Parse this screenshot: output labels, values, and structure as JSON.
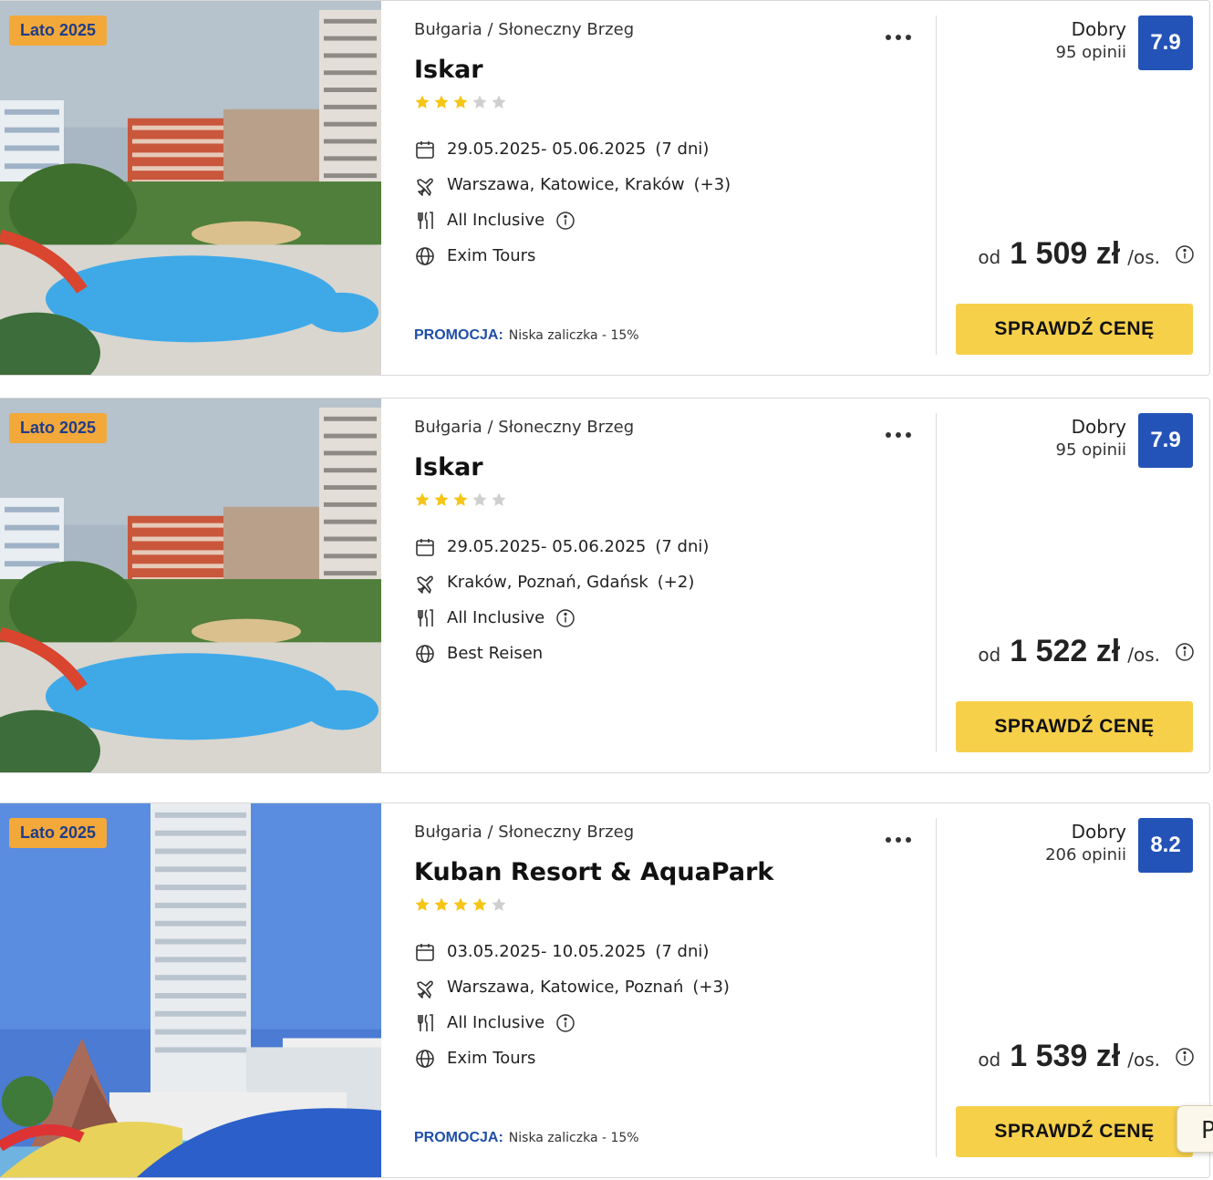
{
  "offers": [
    {
      "season_badge": "Lato 2025",
      "location": "Bułgaria / Słoneczny Brzeg",
      "name": "Iskar",
      "stars": 3,
      "dates": "29.05.2025- 05.06.2025",
      "duration": "(7 dni)",
      "departures": "Warszawa, Katowice, Kraków",
      "departures_more": "(+3)",
      "board": "All Inclusive",
      "operator": "Exim Tours",
      "promo_label": "PROMOCJA:",
      "promo_text": "Niska zaliczka - 15%",
      "rating_label": "Dobry",
      "reviews": "95 opinii",
      "score": "7.9",
      "price_from": "od",
      "price": "1 509 zł",
      "price_unit": "/os.",
      "cta": "SPRAWDŹ CENĘ",
      "photo": "hotel-pool"
    },
    {
      "season_badge": "Lato 2025",
      "location": "Bułgaria / Słoneczny Brzeg",
      "name": "Iskar",
      "stars": 3,
      "dates": "29.05.2025- 05.06.2025",
      "duration": "(7 dni)",
      "departures": "Kraków, Poznań, Gdańsk",
      "departures_more": "(+2)",
      "board": "All Inclusive",
      "operator": "Best Reisen",
      "promo_label": "",
      "promo_text": "",
      "rating_label": "Dobry",
      "reviews": "95 opinii",
      "score": "7.9",
      "price_from": "od",
      "price": "1 522 zł",
      "price_unit": "/os.",
      "cta": "SPRAWDŹ CENĘ",
      "photo": "hotel-pool"
    },
    {
      "season_badge": "Lato 2025",
      "location": "Bułgaria / Słoneczny Brzeg",
      "name": "Kuban Resort & AquaPark",
      "stars": 4,
      "dates": "03.05.2025- 10.05.2025",
      "duration": "(7 dni)",
      "departures": "Warszawa, Katowice, Poznań",
      "departures_more": "(+3)",
      "board": "All Inclusive",
      "operator": "Exim Tours",
      "promo_label": "PROMOCJA:",
      "promo_text": "Niska zaliczka - 15%",
      "rating_label": "Dobry",
      "reviews": "206 opinii",
      "score": "8.2",
      "price_from": "od",
      "price": "1 539 zł",
      "price_unit": "/os.",
      "cta": "SPRAWDŹ CENĘ",
      "photo": "aquapark"
    }
  ],
  "floating_tab": "P",
  "colors": {
    "badge_bg": "#f3a83a",
    "badge_text": "#1f3d8a",
    "score_bg": "#2453b8",
    "cta_bg": "#f7d04a",
    "promo": "#1f4ea8",
    "star_on": "#f5c518",
    "star_off": "#cfcfcf"
  }
}
